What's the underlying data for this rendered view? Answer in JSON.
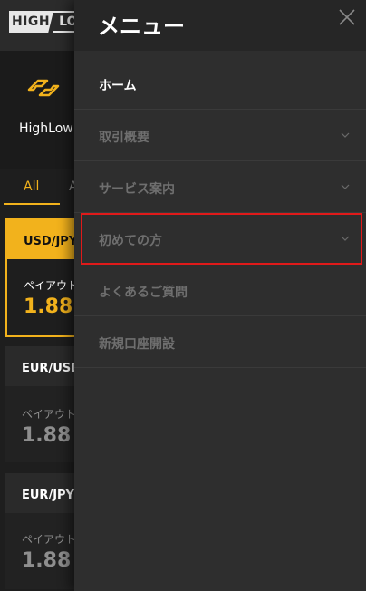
{
  "app": {
    "logo": {
      "part1": "HIGH",
      "part2": "LO"
    },
    "brand_label": "HighLow",
    "filters": {
      "all": "All",
      "second": "A"
    },
    "cards": [
      {
        "pair": "USD/JPY",
        "payout_label": "ペイアウト",
        "payout_value": "1.88",
        "active": true
      },
      {
        "pair": "EUR/USD",
        "payout_label": "ペイアウト",
        "payout_value": "1.88",
        "active": false
      },
      {
        "pair": "EUR/JPY",
        "payout_label": "ペイアウト",
        "payout_value": "1.88",
        "active": false
      }
    ],
    "colors": {
      "accent": "#f2b21c",
      "highlight_box": "#e01a1a"
    }
  },
  "drawer": {
    "title": "メニュー",
    "close_icon": "close-icon",
    "items": [
      {
        "label": "ホーム",
        "expandable": false
      },
      {
        "label": "取引概要",
        "expandable": true
      },
      {
        "label": "サービス案内",
        "expandable": true
      },
      {
        "label": "初めての方",
        "expandable": true,
        "highlighted": true
      },
      {
        "label": "よくあるご質問",
        "expandable": false
      },
      {
        "label": "新規口座開設",
        "expandable": false
      }
    ]
  }
}
